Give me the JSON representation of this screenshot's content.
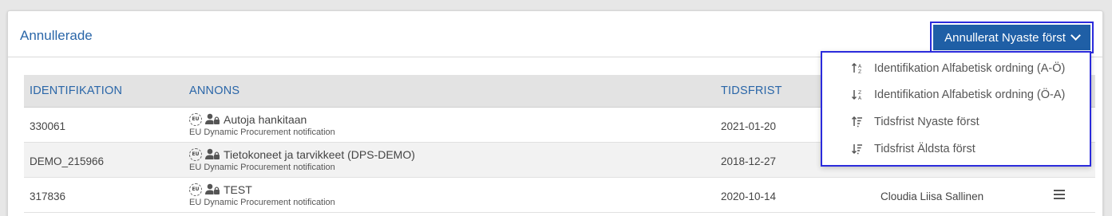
{
  "panel": {
    "title": "Annullerade",
    "sort_button_label": "Annullerat Nyaste först"
  },
  "table": {
    "headers": [
      "IDENTIFIKATION",
      "ANNONS",
      "TIDSFRIST"
    ],
    "rows": [
      {
        "id": "330061",
        "title": "Autoja hankitaan",
        "subtitle": "EU Dynamic Procurement notification",
        "deadline": "2021-01-20",
        "user": ""
      },
      {
        "id": "DEMO_215966",
        "title": "Tietokoneet ja tarvikkeet (DPS-DEMO)",
        "subtitle": "EU Dynamic Procurement notification",
        "deadline": "2018-12-27",
        "user": ""
      },
      {
        "id": "317836",
        "title": "TEST",
        "subtitle": "EU Dynamic Procurement notification",
        "deadline": "2020-10-14",
        "user": "Cloudia Liisa Sallinen"
      }
    ],
    "eu_badge": "EU"
  },
  "dropdown": {
    "items": [
      {
        "label": "Identifikation Alfabetisk ordning (A-Ö)",
        "icon": "sort-alpha-asc-icon"
      },
      {
        "label": "Identifikation Alfabetisk ordning (Ö-A)",
        "icon": "sort-alpha-desc-icon"
      },
      {
        "label": "Tidsfrist Nyaste först",
        "icon": "sort-amount-asc-icon"
      },
      {
        "label": "Tidsfrist Äldsta först",
        "icon": "sort-amount-desc-icon"
      }
    ]
  },
  "colors": {
    "accent": "#1f5fa6",
    "heading_text": "#2a66a8",
    "focus_outline": "#2b2bdc"
  }
}
